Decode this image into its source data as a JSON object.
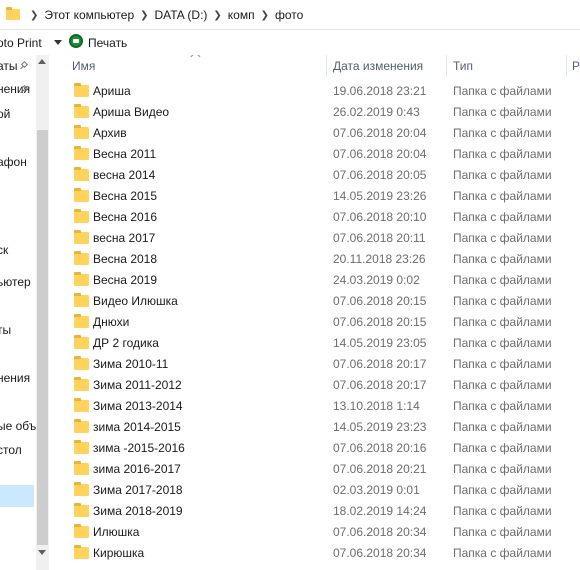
{
  "address": {
    "icon": "folder-icon",
    "crumbs": [
      "Этот компьютер",
      "DATA (D:)",
      "комп",
      "фото"
    ]
  },
  "toolbar": {
    "photo_print_label": "oto Print",
    "print_label": "Печать"
  },
  "nav": {
    "items": [
      "аты",
      "нения",
      "ой",
      "афон",
      "ск",
      "ьютер",
      "ты",
      "нения",
      "ые объ",
      "стол"
    ]
  },
  "columns": {
    "name": "Имя",
    "date": "Дата изменения",
    "type": "Тип",
    "size": "Р"
  },
  "files": [
    {
      "name": "Ариша",
      "date": "19.06.2018 23:21",
      "type": "Папка с файлами"
    },
    {
      "name": "Ариша Видео",
      "date": "26.02.2019 0:43",
      "type": "Папка с файлами"
    },
    {
      "name": "Архив",
      "date": "07.06.2018 20:04",
      "type": "Папка с файлами"
    },
    {
      "name": "Весна 2011",
      "date": "07.06.2018 20:04",
      "type": "Папка с файлами"
    },
    {
      "name": "весна 2014",
      "date": "07.06.2018 20:05",
      "type": "Папка с файлами"
    },
    {
      "name": "Весна 2015",
      "date": "14.05.2019 23:26",
      "type": "Папка с файлами"
    },
    {
      "name": "Весна 2016",
      "date": "07.06.2018 20:10",
      "type": "Папка с файлами"
    },
    {
      "name": "весна 2017",
      "date": "07.06.2018 20:11",
      "type": "Папка с файлами"
    },
    {
      "name": "Весна 2018",
      "date": "20.11.2018 23:26",
      "type": "Папка с файлами"
    },
    {
      "name": "Весна 2019",
      "date": "24.03.2019 0:02",
      "type": "Папка с файлами"
    },
    {
      "name": "Видео Илюшка",
      "date": "07.06.2018 20:15",
      "type": "Папка с файлами"
    },
    {
      "name": "Днюхи",
      "date": "07.06.2018 20:15",
      "type": "Папка с файлами"
    },
    {
      "name": "ДР 2 годика",
      "date": "14.05.2019 23:05",
      "type": "Папка с файлами"
    },
    {
      "name": "Зима 2010-11",
      "date": "07.06.2018 20:17",
      "type": "Папка с файлами"
    },
    {
      "name": "Зима 2011-2012",
      "date": "07.06.2018 20:17",
      "type": "Папка с файлами"
    },
    {
      "name": "Зима 2013-2014",
      "date": "13.10.2018 1:14",
      "type": "Папка с файлами"
    },
    {
      "name": "зима 2014-2015",
      "date": "14.05.2019 23:23",
      "type": "Папка с файлами"
    },
    {
      "name": "зима -2015-2016",
      "date": "07.06.2018 20:16",
      "type": "Папка с файлами"
    },
    {
      "name": "зима 2016-2017",
      "date": "07.06.2018 20:21",
      "type": "Папка с файлами"
    },
    {
      "name": "Зима 2017-2018",
      "date": "02.03.2019 0:01",
      "type": "Папка с файлами"
    },
    {
      "name": "Зима 2018-2019",
      "date": "18.02.2019 14:24",
      "type": "Папка с файлами"
    },
    {
      "name": "Илюшка",
      "date": "07.06.2018 20:34",
      "type": "Папка с файлами"
    },
    {
      "name": "Кирюшка",
      "date": "07.06.2018 20:34",
      "type": "Папка с файлами"
    }
  ],
  "colors": {
    "folder": "#ffd35c",
    "selection": "#cce8ff",
    "header_text": "#4c607a"
  }
}
